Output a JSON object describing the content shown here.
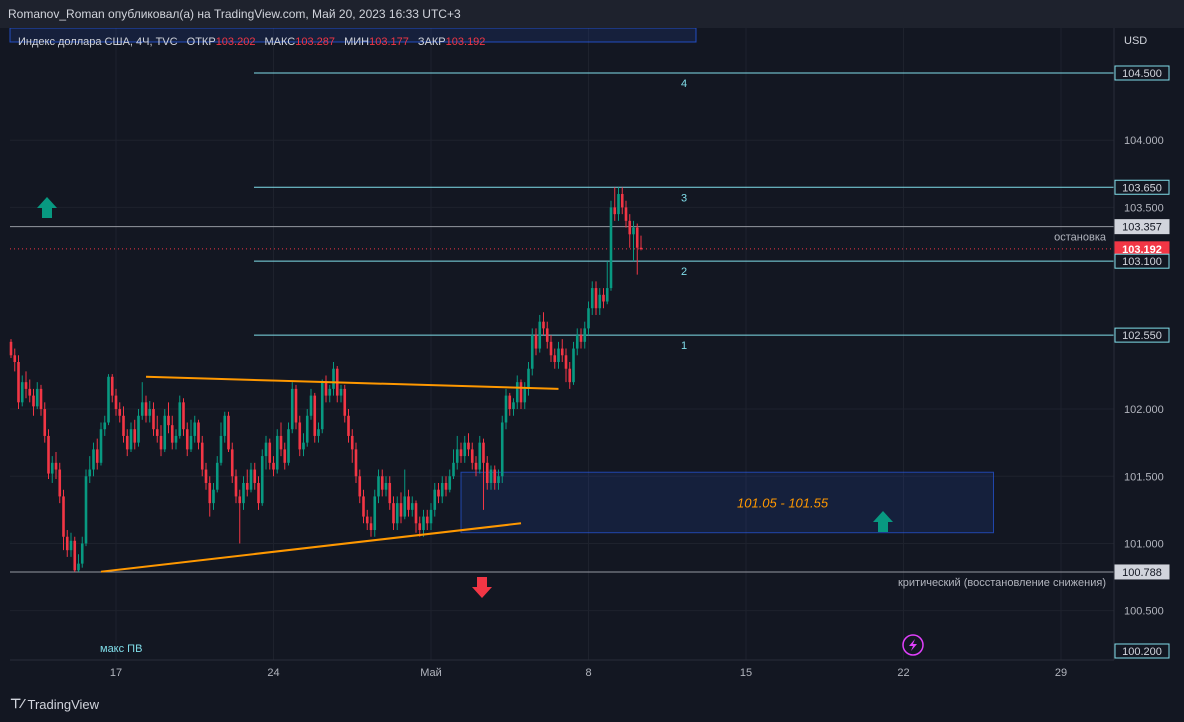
{
  "publisher": "Romanov_Roman опубликовал(а) на TradingView.com, Май 20, 2023 16:33 UTC+3",
  "legend": {
    "symbol": "Индекс доллара США, 4Ч, TVC",
    "open_label": "ОТКР",
    "open": "103.202",
    "high_label": "МАКС",
    "high": "103.287",
    "low_label": "МИН",
    "low": "103.177",
    "close_label": "ЗАКР",
    "close": "103.192"
  },
  "currency": "USD",
  "footer_logo": "TradingView",
  "colors": {
    "up": "#089981",
    "down": "#f23645",
    "level": "#80deea",
    "triangle": "#ff9800",
    "zone": "#2962ff",
    "bg": "#131722"
  },
  "chart_data": {
    "type": "candlestick",
    "x_ticks": [
      {
        "label": "17",
        "bar": 28
      },
      {
        "label": "24",
        "bar": 70
      },
      {
        "label": "Май",
        "bar": 112
      },
      {
        "label": "8",
        "bar": 154
      },
      {
        "label": "15",
        "bar": 196
      },
      {
        "label": "22",
        "bar": 238
      },
      {
        "label": "29",
        "bar": 280
      }
    ],
    "y_ticks": [
      "100.500",
      "101.000",
      "101.500",
      "102.000",
      "103.500",
      "104.000"
    ],
    "ylim": [
      100.2,
      104.7
    ],
    "price_labels": [
      {
        "value": "104.500",
        "kind": "level"
      },
      {
        "value": "103.650",
        "kind": "level"
      },
      {
        "value": "103.357",
        "kind": "stop"
      },
      {
        "value": "103.192",
        "kind": "last"
      },
      {
        "value": "103.100",
        "kind": "level"
      },
      {
        "value": "102.550",
        "kind": "level"
      },
      {
        "value": "100.788",
        "kind": "critical"
      },
      {
        "value": "100.200",
        "kind": "bottom"
      }
    ],
    "levels": [
      {
        "label": "4",
        "price": 104.5
      },
      {
        "label": "3",
        "price": 103.65
      },
      {
        "label": "2",
        "price": 103.1
      },
      {
        "label": "1",
        "price": 102.55
      }
    ],
    "stop_line": {
      "price": 103.357,
      "label": "остановка"
    },
    "critical_line": {
      "price": 100.788,
      "label": "критический (восстановление снижения)"
    },
    "zone": {
      "low": 101.08,
      "high": 101.53,
      "bar_start": 120,
      "bar_end": 262,
      "label": "101.05 - 101.55"
    },
    "triangle": {
      "upper": [
        [
          36,
          102.24
        ],
        [
          146,
          102.15
        ]
      ],
      "lower": [
        [
          24,
          100.79
        ],
        [
          136,
          101.15
        ]
      ]
    },
    "annotations": {
      "max_pv": "макс ПВ"
    },
    "candles": [
      [
        102.5,
        102.4,
        102.52,
        102.38
      ],
      [
        102.4,
        102.35,
        102.45,
        102.28
      ],
      [
        102.35,
        102.05,
        102.4,
        102.0
      ],
      [
        102.05,
        102.2,
        102.25,
        102.02
      ],
      [
        102.2,
        102.15,
        102.28,
        102.08
      ],
      [
        102.15,
        102.1,
        102.22,
        102.05
      ],
      [
        102.1,
        102.02,
        102.15,
        101.95
      ],
      [
        102.02,
        102.15,
        102.2,
        102.0
      ],
      [
        102.15,
        102.0,
        102.18,
        101.95
      ],
      [
        102.0,
        101.8,
        102.05,
        101.75
      ],
      [
        101.8,
        101.52,
        101.85,
        101.48
      ],
      [
        101.52,
        101.6,
        101.65,
        101.45
      ],
      [
        101.6,
        101.55,
        101.68,
        101.48
      ],
      [
        101.55,
        101.35,
        101.6,
        101.3
      ],
      [
        101.35,
        101.05,
        101.4,
        100.95
      ],
      [
        101.05,
        100.95,
        101.1,
        100.9
      ],
      [
        100.95,
        101.02,
        101.08,
        100.9
      ],
      [
        101.02,
        100.8,
        101.05,
        100.79
      ],
      [
        100.8,
        100.85,
        100.92,
        100.79
      ],
      [
        100.85,
        101.0,
        101.05,
        100.82
      ],
      [
        101.0,
        101.5,
        101.55,
        100.98
      ],
      [
        101.5,
        101.55,
        101.65,
        101.45
      ],
      [
        101.55,
        101.7,
        101.75,
        101.5
      ],
      [
        101.7,
        101.6,
        101.78,
        101.55
      ],
      [
        101.6,
        101.85,
        101.9,
        101.58
      ],
      [
        101.85,
        101.9,
        101.95,
        101.8
      ],
      [
        101.9,
        102.24,
        102.26,
        101.88
      ],
      [
        102.24,
        102.1,
        102.26,
        102.05
      ],
      [
        102.1,
        102.0,
        102.15,
        101.95
      ],
      [
        102.0,
        101.95,
        102.05,
        101.9
      ],
      [
        101.95,
        101.8,
        102.02,
        101.75
      ],
      [
        101.8,
        101.7,
        101.85,
        101.65
      ],
      [
        101.7,
        101.85,
        101.9,
        101.68
      ],
      [
        101.85,
        101.75,
        101.92,
        101.7
      ],
      [
        101.75,
        101.95,
        102.0,
        101.72
      ],
      [
        101.95,
        102.05,
        102.2,
        101.92
      ],
      [
        102.05,
        101.95,
        102.1,
        101.9
      ],
      [
        101.95,
        102.0,
        102.06,
        101.9
      ],
      [
        102.0,
        101.85,
        102.05,
        101.8
      ],
      [
        101.85,
        101.8,
        101.95,
        101.75
      ],
      [
        101.8,
        101.7,
        101.88,
        101.65
      ],
      [
        101.7,
        101.95,
        102.0,
        101.68
      ],
      [
        101.95,
        101.88,
        102.05,
        101.82
      ],
      [
        101.88,
        101.75,
        101.95,
        101.7
      ],
      [
        101.75,
        101.8,
        101.85,
        101.7
      ],
      [
        101.8,
        102.05,
        102.1,
        101.78
      ],
      [
        102.05,
        101.85,
        102.08,
        101.8
      ],
      [
        101.85,
        101.7,
        101.9,
        101.65
      ],
      [
        101.7,
        101.8,
        101.92,
        101.68
      ],
      [
        101.8,
        101.9,
        101.95,
        101.75
      ],
      [
        101.9,
        101.75,
        101.92,
        101.7
      ],
      [
        101.75,
        101.55,
        101.8,
        101.5
      ],
      [
        101.55,
        101.45,
        101.6,
        101.4
      ],
      [
        101.45,
        101.3,
        101.5,
        101.2
      ],
      [
        101.3,
        101.4,
        101.45,
        101.25
      ],
      [
        101.4,
        101.6,
        101.65,
        101.38
      ],
      [
        101.6,
        101.8,
        101.9,
        101.58
      ],
      [
        101.8,
        101.95,
        101.98,
        101.75
      ],
      [
        101.95,
        101.7,
        101.98,
        101.68
      ],
      [
        101.7,
        101.5,
        101.75,
        101.45
      ],
      [
        101.5,
        101.35,
        101.55,
        101.3
      ],
      [
        101.35,
        101.3,
        101.4,
        101.0
      ],
      [
        101.3,
        101.45,
        101.5,
        101.25
      ],
      [
        101.45,
        101.4,
        101.55,
        101.35
      ],
      [
        101.4,
        101.55,
        101.6,
        101.38
      ],
      [
        101.55,
        101.45,
        101.6,
        101.4
      ],
      [
        101.45,
        101.3,
        101.5,
        101.25
      ],
      [
        101.3,
        101.65,
        101.7,
        101.28
      ],
      [
        101.65,
        101.75,
        101.8,
        101.55
      ],
      [
        101.75,
        101.6,
        101.78,
        101.55
      ],
      [
        101.6,
        101.55,
        101.65,
        101.5
      ],
      [
        101.55,
        101.8,
        101.85,
        101.52
      ],
      [
        101.8,
        101.7,
        101.9,
        101.65
      ],
      [
        101.7,
        101.6,
        101.75,
        101.55
      ],
      [
        101.6,
        101.85,
        101.9,
        101.58
      ],
      [
        101.85,
        102.15,
        102.2,
        101.82
      ],
      [
        102.15,
        101.9,
        102.18,
        101.85
      ],
      [
        101.9,
        101.7,
        101.95,
        101.65
      ],
      [
        101.7,
        101.75,
        101.82,
        101.65
      ],
      [
        101.75,
        101.95,
        102.0,
        101.72
      ],
      [
        101.95,
        102.1,
        102.15,
        101.92
      ],
      [
        102.1,
        101.8,
        102.12,
        101.75
      ],
      [
        101.8,
        101.85,
        101.9,
        101.75
      ],
      [
        101.85,
        102.2,
        102.22,
        101.82
      ],
      [
        102.2,
        102.1,
        102.25,
        102.05
      ],
      [
        102.1,
        102.15,
        102.18,
        102.05
      ],
      [
        102.15,
        102.3,
        102.35,
        102.1
      ],
      [
        102.3,
        102.1,
        102.32,
        102.05
      ],
      [
        102.1,
        102.15,
        102.18,
        102.05
      ],
      [
        102.15,
        101.95,
        102.18,
        101.9
      ],
      [
        101.95,
        101.8,
        102.0,
        101.75
      ],
      [
        101.8,
        101.7,
        101.85,
        101.6
      ],
      [
        101.7,
        101.5,
        101.75,
        101.45
      ],
      [
        101.5,
        101.35,
        101.55,
        101.3
      ],
      [
        101.35,
        101.2,
        101.4,
        101.15
      ],
      [
        101.2,
        101.15,
        101.25,
        101.1
      ],
      [
        101.15,
        101.1,
        101.2,
        101.05
      ],
      [
        101.1,
        101.35,
        101.4,
        101.05
      ],
      [
        101.35,
        101.5,
        101.55,
        101.3
      ],
      [
        101.5,
        101.4,
        101.55,
        101.35
      ],
      [
        101.4,
        101.45,
        101.5,
        101.35
      ],
      [
        101.45,
        101.3,
        101.5,
        101.25
      ],
      [
        101.3,
        101.15,
        101.35,
        101.1
      ],
      [
        101.15,
        101.3,
        101.35,
        101.1
      ],
      [
        101.3,
        101.2,
        101.38,
        101.15
      ],
      [
        101.2,
        101.35,
        101.55,
        101.18
      ],
      [
        101.35,
        101.25,
        101.4,
        101.2
      ],
      [
        101.25,
        101.3,
        101.35,
        101.2
      ],
      [
        101.3,
        101.15,
        101.32,
        101.08
      ],
      [
        101.15,
        101.1,
        101.2,
        101.05
      ],
      [
        101.1,
        101.2,
        101.25,
        101.05
      ],
      [
        101.2,
        101.15,
        101.25,
        101.1
      ],
      [
        101.15,
        101.25,
        101.3,
        101.1
      ],
      [
        101.25,
        101.4,
        101.45,
        101.2
      ],
      [
        101.4,
        101.35,
        101.45,
        101.3
      ],
      [
        101.35,
        101.45,
        101.5,
        101.3
      ],
      [
        101.45,
        101.4,
        101.5,
        101.35
      ],
      [
        101.4,
        101.5,
        101.55,
        101.38
      ],
      [
        101.5,
        101.6,
        101.7,
        101.48
      ],
      [
        101.6,
        101.7,
        101.8,
        101.55
      ],
      [
        101.7,
        101.65,
        101.75,
        101.6
      ],
      [
        101.65,
        101.75,
        101.8,
        101.6
      ],
      [
        101.75,
        101.7,
        101.82,
        101.65
      ],
      [
        101.7,
        101.6,
        101.75,
        101.55
      ],
      [
        101.6,
        101.55,
        101.65,
        101.5
      ],
      [
        101.55,
        101.75,
        101.8,
        101.52
      ],
      [
        101.75,
        101.6,
        101.78,
        101.25
      ],
      [
        101.6,
        101.45,
        101.65,
        101.4
      ],
      [
        101.45,
        101.55,
        101.58,
        101.4
      ],
      [
        101.55,
        101.45,
        101.58,
        101.4
      ],
      [
        101.45,
        101.5,
        101.55,
        101.4
      ],
      [
        101.5,
        101.9,
        101.95,
        101.45
      ],
      [
        101.9,
        102.1,
        102.15,
        101.85
      ],
      [
        102.1,
        102.0,
        102.12,
        101.95
      ],
      [
        102.0,
        102.05,
        102.08,
        101.95
      ],
      [
        102.05,
        102.2,
        102.25,
        102.0
      ],
      [
        102.2,
        102.05,
        102.22,
        102.0
      ],
      [
        102.05,
        102.15,
        102.2,
        102.0
      ],
      [
        102.15,
        102.3,
        102.35,
        102.1
      ],
      [
        102.3,
        102.55,
        102.6,
        102.25
      ],
      [
        102.55,
        102.45,
        102.6,
        102.4
      ],
      [
        102.45,
        102.65,
        102.7,
        102.42
      ],
      [
        102.65,
        102.6,
        102.72,
        102.55
      ],
      [
        102.6,
        102.5,
        102.65,
        102.45
      ],
      [
        102.5,
        102.4,
        102.55,
        102.35
      ],
      [
        102.4,
        102.35,
        102.45,
        102.3
      ],
      [
        102.35,
        102.45,
        102.5,
        102.3
      ],
      [
        102.45,
        102.4,
        102.52,
        102.35
      ],
      [
        102.4,
        102.3,
        102.45,
        102.2
      ],
      [
        102.3,
        102.2,
        102.35,
        102.15
      ],
      [
        102.2,
        102.45,
        102.5,
        102.18
      ],
      [
        102.45,
        102.55,
        102.6,
        102.4
      ],
      [
        102.55,
        102.5,
        102.6,
        102.45
      ],
      [
        102.5,
        102.6,
        102.65,
        102.45
      ],
      [
        102.6,
        102.75,
        102.8,
        102.55
      ],
      [
        102.75,
        102.9,
        102.95,
        102.7
      ],
      [
        102.9,
        102.75,
        102.95,
        102.7
      ],
      [
        102.75,
        102.85,
        102.9,
        102.7
      ],
      [
        102.85,
        102.8,
        102.9,
        102.75
      ],
      [
        102.8,
        102.9,
        103.1,
        102.78
      ],
      [
        102.9,
        103.5,
        103.55,
        102.88
      ],
      [
        103.5,
        103.45,
        103.65,
        103.4
      ],
      [
        103.45,
        103.6,
        103.65,
        103.4
      ],
      [
        103.6,
        103.5,
        103.65,
        103.45
      ],
      [
        103.5,
        103.4,
        103.55,
        103.35
      ],
      [
        103.4,
        103.3,
        103.45,
        103.2
      ],
      [
        103.3,
        103.35,
        103.4,
        103.1
      ],
      [
        103.35,
        103.2,
        103.38,
        103.0
      ],
      [
        103.2,
        103.19,
        103.29,
        103.18
      ]
    ]
  }
}
